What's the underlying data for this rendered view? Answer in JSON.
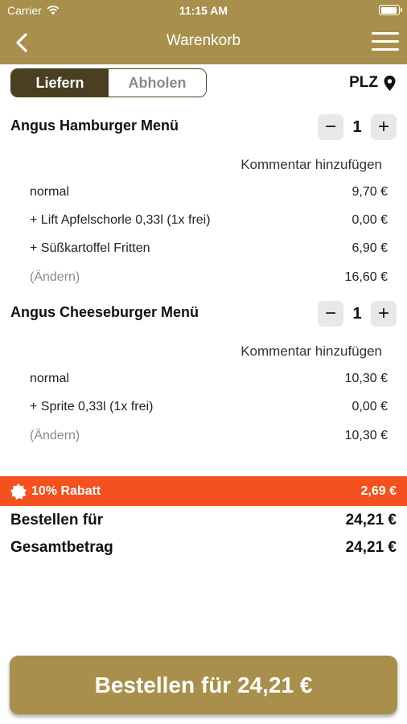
{
  "status": {
    "carrier": "Carrier",
    "time": "11:15 AM"
  },
  "nav": {
    "title": "Warenkorb",
    "back_icon": "chevron-left-icon",
    "menu_icon": "hamburger-menu-icon"
  },
  "segment": {
    "deliver": "Liefern",
    "pickup": "Abholen",
    "selected": "Liefern"
  },
  "plz": {
    "label": "PLZ",
    "icon": "location-pin-icon"
  },
  "items": [
    {
      "title": "Angus Hamburger Menü",
      "qty": "1",
      "comment": "Kommentar hinzufügen",
      "lines": [
        {
          "label": "normal",
          "price": "9,70 €"
        },
        {
          "label": "+ Lift Apfelschorle 0,33l (1x frei)",
          "price": "0,00 €"
        },
        {
          "label": "+ Süßkartoffel Fritten",
          "price": "6,90 €"
        },
        {
          "label": "(Ändern)",
          "price": "16,60 €"
        }
      ]
    },
    {
      "title": "Angus Cheeseburger Menü",
      "qty": "1",
      "comment": "Kommentar hinzufügen",
      "lines": [
        {
          "label": "normal",
          "price": "10,30 €"
        },
        {
          "label": "+ Sprite 0,33l (1x frei)",
          "price": "0,00 €"
        },
        {
          "label": "(Ändern)",
          "price": "10,30 €"
        }
      ]
    }
  ],
  "discount": {
    "label": "10% Rabatt",
    "amount": "2,69 €",
    "icon": "badge-icon"
  },
  "summary": {
    "order_for_label": "Bestellen für",
    "order_for_value": "24,21 €",
    "total_label": "Gesamtbetrag",
    "total_value": "24,21 €"
  },
  "cta": {
    "label": "Bestellen für 24,21 €"
  },
  "colors": {
    "primary": "#a8904c",
    "dark": "#4a3f20",
    "discount": "#f4511e"
  }
}
